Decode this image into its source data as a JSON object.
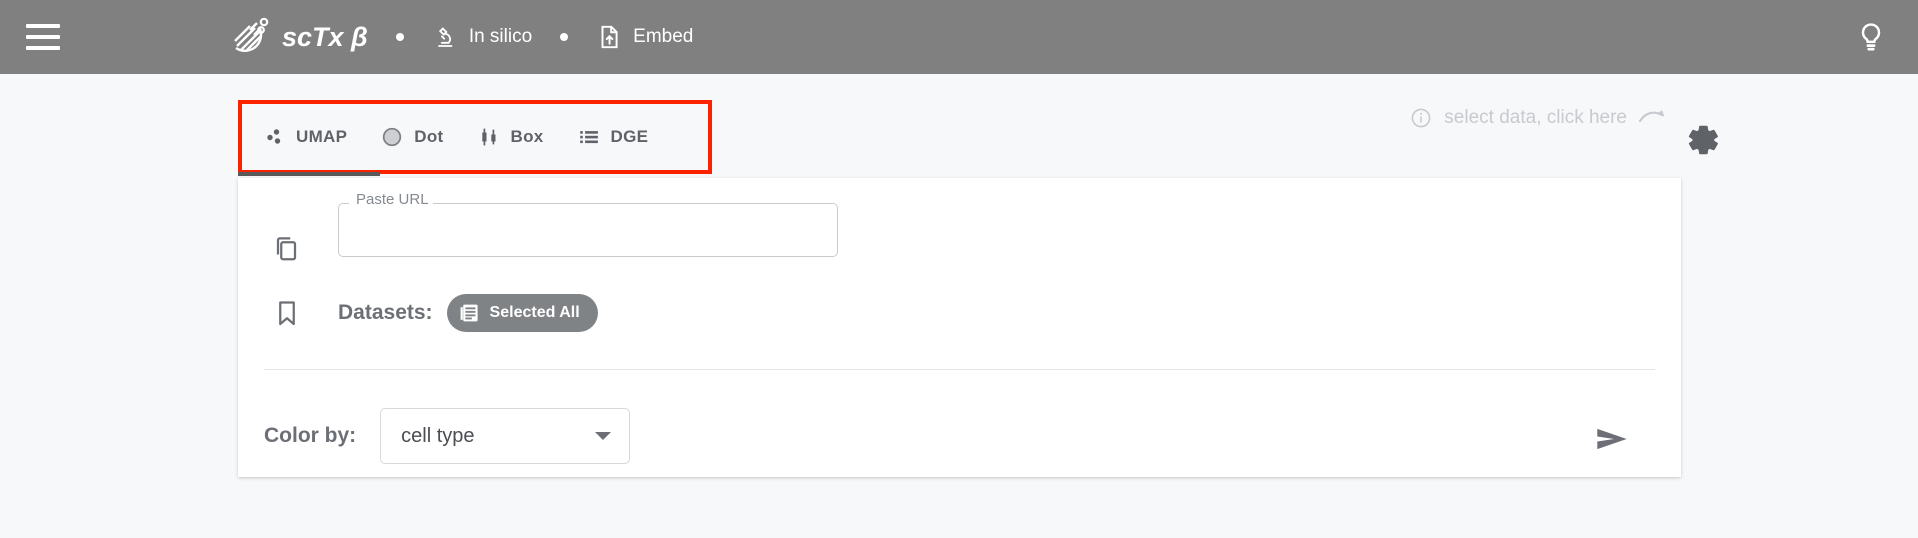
{
  "appbar": {
    "menu_icon": "hamburger-menu-icon",
    "logo_icon": "sctx-logo-icon",
    "brand_title": "scTx β",
    "separator": "•",
    "nav": [
      {
        "icon": "microscope-icon",
        "label": "In silico"
      },
      {
        "icon": "file-upload-icon",
        "label": "Embed"
      }
    ],
    "bulb_icon": "lightbulb-icon",
    "background_color": "#808080"
  },
  "tabs": {
    "highlight_color": "#fb2200",
    "active_index": 0,
    "items": [
      {
        "icon": "scatter-dots-icon",
        "label": "UMAP"
      },
      {
        "icon": "circle-icon",
        "label": "Dot"
      },
      {
        "icon": "boxplot-icon",
        "label": "Box"
      },
      {
        "icon": "bulleted-list-icon",
        "label": "DGE"
      }
    ]
  },
  "hint": {
    "info_icon": "info-circle-icon",
    "text": "select data, click here",
    "arrow_icon": "curved-arrow-icon",
    "gear_icon": "gear-icon"
  },
  "card": {
    "url_row": {
      "lead_icon": "copy-icon",
      "field_label": "Paste URL",
      "field_value": "",
      "field_placeholder": ""
    },
    "datasets_row": {
      "lead_icon": "bookmark-icon",
      "label": "Datasets:",
      "chip": {
        "icon": "article-icon",
        "text": "Selected All",
        "color": "#808386"
      }
    },
    "color_row": {
      "label": "Color by:",
      "select_value": "cell type",
      "select_options": [
        "cell type"
      ],
      "arrow_icon": "chevron-down-icon"
    },
    "send_icon": "send-arrow-icon"
  }
}
